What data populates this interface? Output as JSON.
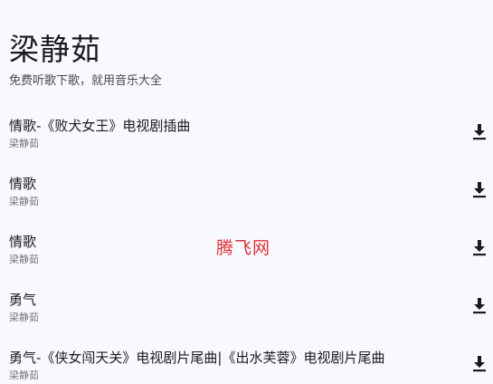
{
  "header": {
    "title": "梁静茹",
    "subtitle": "免费听歌下歌，就用音乐大全"
  },
  "songs": [
    {
      "title": "情歌-《败犬女王》电视剧插曲",
      "artist": "梁静茹",
      "action_icon": "download-icon"
    },
    {
      "title": "情歌",
      "artist": "梁静茹",
      "action_icon": "download-icon"
    },
    {
      "title": "情歌",
      "artist": "梁静茹",
      "action_icon": "download-icon"
    },
    {
      "title": "勇气",
      "artist": "梁静茹",
      "action_icon": "download-icon"
    },
    {
      "title": "勇气-《侠女闯天关》电视剧片尾曲|《出水芙蓉》电视剧片尾曲",
      "artist": "梁静茹",
      "action_icon": "download-icon"
    }
  ],
  "watermark": {
    "text": "腾飞网",
    "color": "#e0303a"
  },
  "colors": {
    "background": "#f8f9fc",
    "title_text": "#1b1b1f",
    "secondary_text": "#74777f",
    "icon": "#1b1b1f"
  }
}
